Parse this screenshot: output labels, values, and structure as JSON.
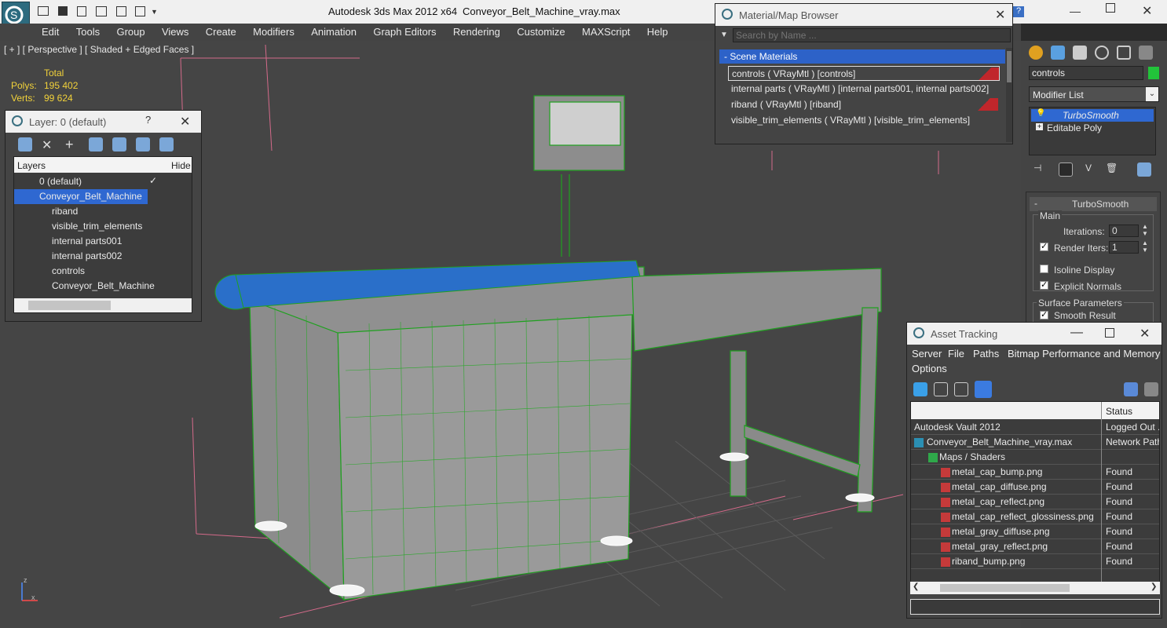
{
  "app": {
    "title": "Autodesk 3ds Max  2012 x64",
    "file": "Conveyor_Belt_Machine_vray.max"
  },
  "menu": [
    "Edit",
    "Tools",
    "Group",
    "Views",
    "Create",
    "Modifiers",
    "Animation",
    "Graph Editors",
    "Rendering",
    "Customize",
    "MAXScript",
    "Help"
  ],
  "viewport": {
    "label": "[ + ] [ Perspective ] [ Shaded + Edged Faces ]",
    "stats": {
      "header": "Total",
      "polys_label": "Polys:",
      "polys": "195 402",
      "verts_label": "Verts:",
      "verts": "99 624"
    },
    "axis": {
      "x": "x",
      "y": "y",
      "z": "z"
    }
  },
  "layer_dialog": {
    "title": "Layer: 0 (default)",
    "help": "?",
    "col_layers": "Layers",
    "col_hide": "Hide",
    "rows": [
      "0 (default)",
      "Conveyor_Belt_Machine",
      "riband",
      "visible_trim_elements",
      "internal parts001",
      "internal parts002",
      "controls",
      "Conveyor_Belt_Machine"
    ]
  },
  "material_browser": {
    "title": "Material/Map Browser",
    "search_placeholder": "Search by Name ...",
    "section": "- Scene Materials",
    "items": [
      "controls  ( VRayMtl )  [controls]",
      "internal parts  ( VRayMtl )  [internal parts001, internal parts002]",
      "riband  ( VRayMtl )  [riband]",
      "visible_trim_elements  ( VRayMtl )  [visible_trim_elements]"
    ]
  },
  "command_panel": {
    "object_name": "controls",
    "modifier_list": "Modifier List",
    "stack": [
      "TurboSmooth",
      "Editable Poly"
    ],
    "rollout_title": "TurboSmooth",
    "main_group": "Main",
    "iterations_label": "Iterations:",
    "iterations": "0",
    "render_iters_label": "Render Iters:",
    "render_iters": "1",
    "isoline": "Isoline Display",
    "explicit_normals": "Explicit Normals",
    "surface_group": "Surface Parameters",
    "smooth_result": "Smooth Result",
    "color_swatch": "#22c33a"
  },
  "asset_tracking": {
    "title": "Asset Tracking",
    "menus": [
      "Server",
      "File",
      "Paths",
      "Bitmap Performance and Memory",
      "Options"
    ],
    "col_status": "Status",
    "rows": [
      {
        "name": "Autodesk Vault 2012",
        "status": "Logged Out ..."
      },
      {
        "name": "Conveyor_Belt_Machine_vray.max",
        "status": "Network Path"
      },
      {
        "name": "Maps / Shaders",
        "status": ""
      },
      {
        "name": "metal_cap_bump.png",
        "status": "Found"
      },
      {
        "name": "metal_cap_diffuse.png",
        "status": "Found"
      },
      {
        "name": "metal_cap_reflect.png",
        "status": "Found"
      },
      {
        "name": "metal_cap_reflect_glossiness.png",
        "status": "Found"
      },
      {
        "name": "metal_gray_diffuse.png",
        "status": "Found"
      },
      {
        "name": "metal_gray_reflect.png",
        "status": "Found"
      },
      {
        "name": "riband_bump.png",
        "status": "Found"
      }
    ]
  }
}
